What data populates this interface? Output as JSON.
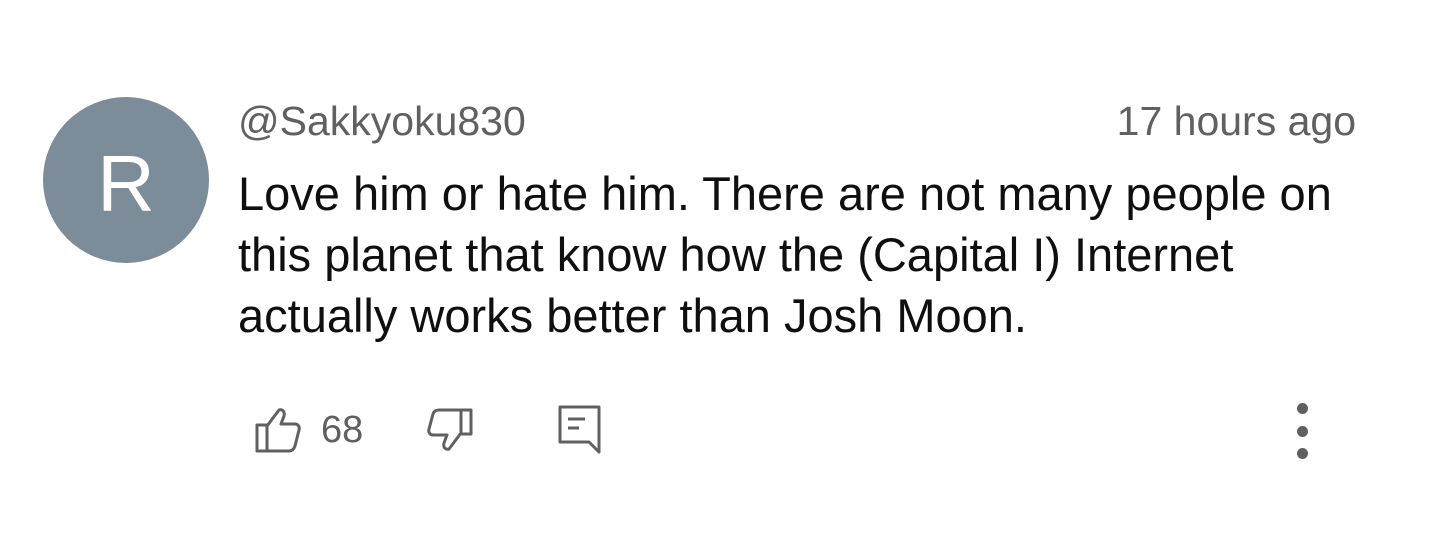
{
  "comment": {
    "avatar_letter": "R",
    "avatar_color": "#7c8c99",
    "username": "@Sakkyoku830",
    "timestamp": "17 hours ago",
    "text": "Love him or hate him. There are not many people on this planet that know how the (Capital I) Internet actually works better than Josh Moon."
  },
  "actions": {
    "like_count": "68",
    "like_icon": "thumbs-up-icon",
    "dislike_icon": "thumbs-down-icon",
    "reply_icon": "reply-comment-icon",
    "more_icon": "more-vertical-icon"
  }
}
